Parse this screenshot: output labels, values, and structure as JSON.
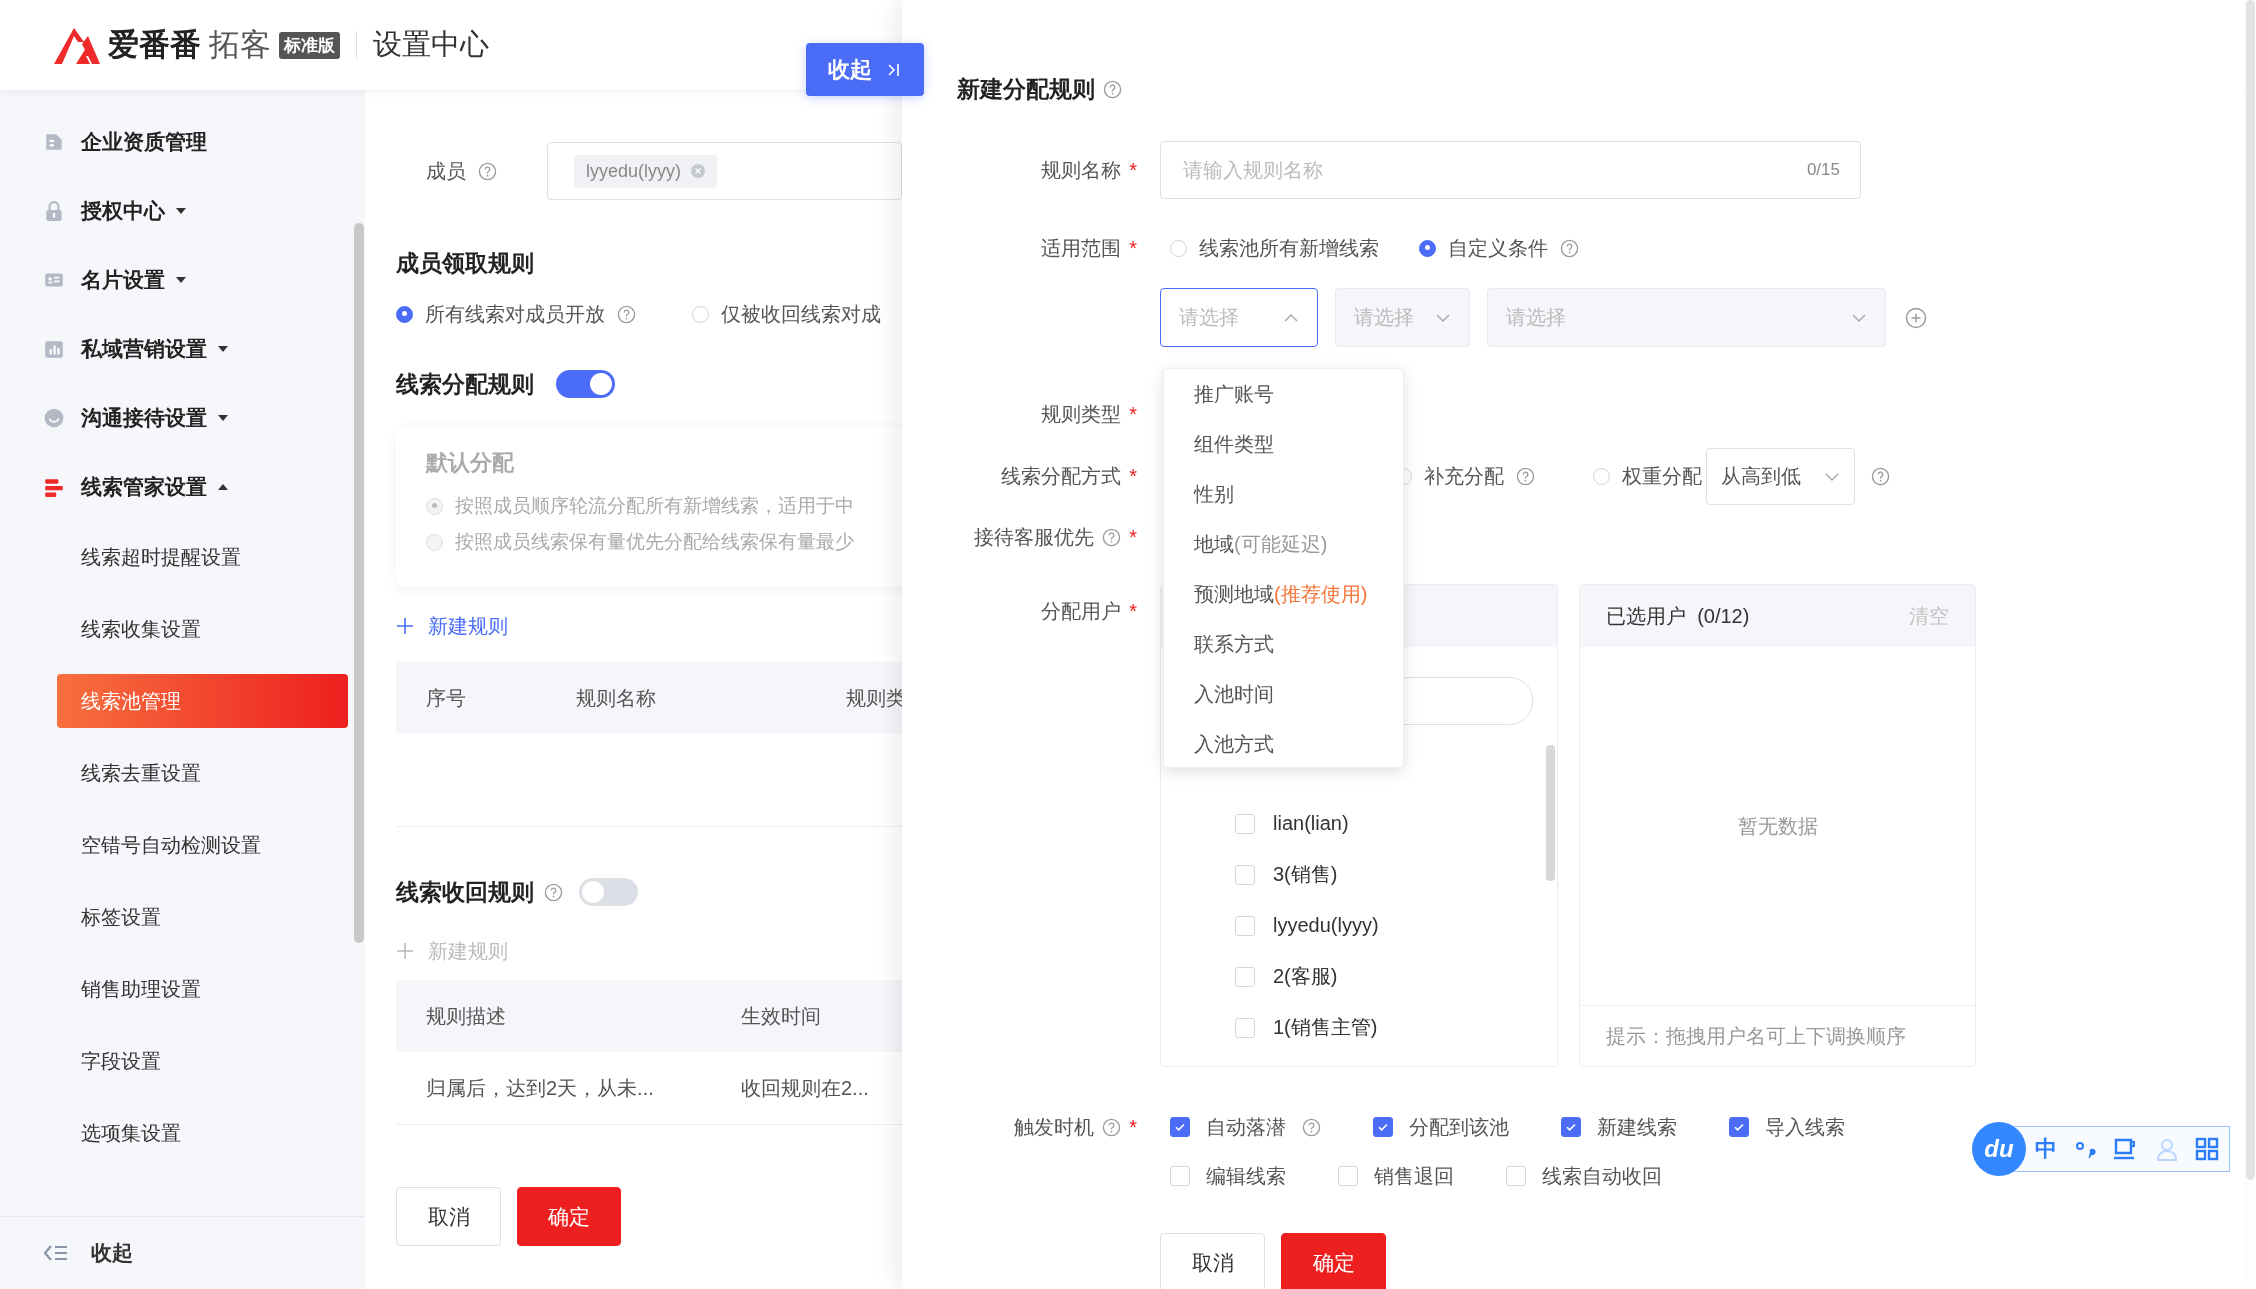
{
  "header": {
    "brand": "爱番番",
    "product": "拓客",
    "edition": "标准版",
    "title": "设置中心"
  },
  "collapse_button": {
    "label": "收起"
  },
  "sidebar": {
    "items": [
      {
        "label": "企业资质管理",
        "kind": "link"
      },
      {
        "label": "授权中心",
        "kind": "group",
        "expanded": false
      },
      {
        "label": "名片设置",
        "kind": "group",
        "expanded": false
      },
      {
        "label": "私域营销设置",
        "kind": "group",
        "expanded": false
      },
      {
        "label": "沟通接待设置",
        "kind": "group",
        "expanded": false
      },
      {
        "label": "线索管家设置",
        "kind": "group",
        "expanded": true,
        "children": [
          {
            "label": "线索超时提醒设置",
            "selected": false
          },
          {
            "label": "线索收集设置",
            "selected": false
          },
          {
            "label": "线索池管理",
            "selected": true
          },
          {
            "label": "线索去重设置",
            "selected": false
          },
          {
            "label": "空错号自动检测设置",
            "selected": false
          },
          {
            "label": "标签设置",
            "selected": false
          },
          {
            "label": "销售助理设置",
            "selected": false
          },
          {
            "label": "字段设置",
            "selected": false
          },
          {
            "label": "选项集设置",
            "selected": false
          }
        ]
      }
    ],
    "footer": "收起"
  },
  "members": {
    "label": "成员",
    "tags": [
      "lyyedu(lyyy)"
    ]
  },
  "claim_rules": {
    "title": "成员领取规则",
    "options": [
      {
        "label": "所有线索对成员开放",
        "selected": true,
        "help": true
      },
      {
        "label": "仅被收回线索对成",
        "selected": false,
        "help": false
      }
    ]
  },
  "distribution_rules": {
    "title": "线索分配规则",
    "on": true,
    "default_card": {
      "title": "默认分配",
      "disabled": true,
      "options": [
        {
          "label": "按照成员顺序轮流分配所有新增线索，适用于中",
          "selected": true
        },
        {
          "label": "按照成员线索保有量优先分配给线索保有量最少",
          "selected": false
        }
      ]
    },
    "new_rule": {
      "label": "新建规则",
      "disabled": false
    },
    "table": {
      "columns": [
        "序号",
        "规则名称",
        "规则类"
      ]
    }
  },
  "recovery_rules": {
    "title": "线索收回规则",
    "on": false,
    "new_rule": {
      "label": "新建规则",
      "disabled": true
    },
    "table": {
      "columns": [
        "规则描述",
        "生效时间"
      ],
      "rows": [
        [
          "归属后，达到2天，从未...",
          "收回规则在2..."
        ]
      ]
    }
  },
  "buttons": [
    {
      "label": "取消",
      "kind": "secondary"
    },
    {
      "label": "确定",
      "kind": "primary"
    }
  ],
  "drawer": {
    "title": "新建分配规则",
    "rule_name": {
      "label": "规则名称",
      "required": "*",
      "placeholder": "请输入规则名称",
      "counter": "0/15"
    },
    "scope": {
      "label": "适用范围",
      "required": "*",
      "options": [
        {
          "label": "线索池所有新增线索",
          "selected": false,
          "help": false
        },
        {
          "label": "自定义条件",
          "selected": true,
          "help": true
        }
      ],
      "selects": [
        {
          "placeholder": "请选择",
          "open": true,
          "disabled": false
        },
        {
          "placeholder": "请选择",
          "open": false,
          "disabled": true
        },
        {
          "placeholder": "请选择",
          "open": false,
          "disabled": true
        }
      ],
      "dropdown": [
        {
          "label": "推广账号"
        },
        {
          "label": "组件类型"
        },
        {
          "label": "性别"
        },
        {
          "label": "地域",
          "note": "(可能延迟)",
          "color": "#999999"
        },
        {
          "label": "预测地域",
          "note": "(推荐使用)",
          "color": "#f7743a"
        },
        {
          "label": "联系方式"
        },
        {
          "label": "入池时间"
        },
        {
          "label": "入池方式"
        }
      ]
    },
    "rule_type": {
      "label": "规则类型",
      "required": "*"
    },
    "method": {
      "label": "线索分配方式",
      "required": "*",
      "options": [
        {
          "label": "补充分配",
          "selected": false,
          "help": true
        },
        {
          "label": "权重分配",
          "selected": false,
          "help": false
        }
      ],
      "order": "从高到低"
    },
    "reception": {
      "label": "接待客服优先",
      "required": "*",
      "help": true
    },
    "assign_users": {
      "label": "分配用户",
      "required": "*",
      "users": [
        {
          "label": "lian(lian)",
          "checked": false
        },
        {
          "label": "3(销售)",
          "checked": false
        },
        {
          "label": "lyyedu(lyyy)",
          "checked": false
        },
        {
          "label": "2(客服)",
          "checked": false
        },
        {
          "label": "1(销售主管)",
          "checked": false
        }
      ],
      "selected_panel": {
        "title": "已选用户",
        "count": "(0/12)",
        "clear": "清空",
        "empty": "暂无数据",
        "hint": "提示：拖拽用户名可上下调换顺序"
      }
    },
    "trigger": {
      "label": "触发时机",
      "required": "*",
      "help": true,
      "options": [
        {
          "label": "自动落潜",
          "checked": true,
          "help": true
        },
        {
          "label": "分配到该池",
          "checked": true,
          "help": false
        },
        {
          "label": "新建线索",
          "checked": true,
          "help": false
        },
        {
          "label": "导入线索",
          "checked": true,
          "help": false
        },
        {
          "label": "编辑线索",
          "checked": false,
          "help": false
        },
        {
          "label": "销售退回",
          "checked": false,
          "help": false
        },
        {
          "label": "线索自动收回",
          "checked": false,
          "help": false
        }
      ]
    },
    "buttons": [
      {
        "label": "取消",
        "kind": "secondary"
      },
      {
        "label": "确定",
        "kind": "primary"
      }
    ]
  },
  "ime_toolbar": {
    "logo": "du",
    "mode": "中"
  }
}
